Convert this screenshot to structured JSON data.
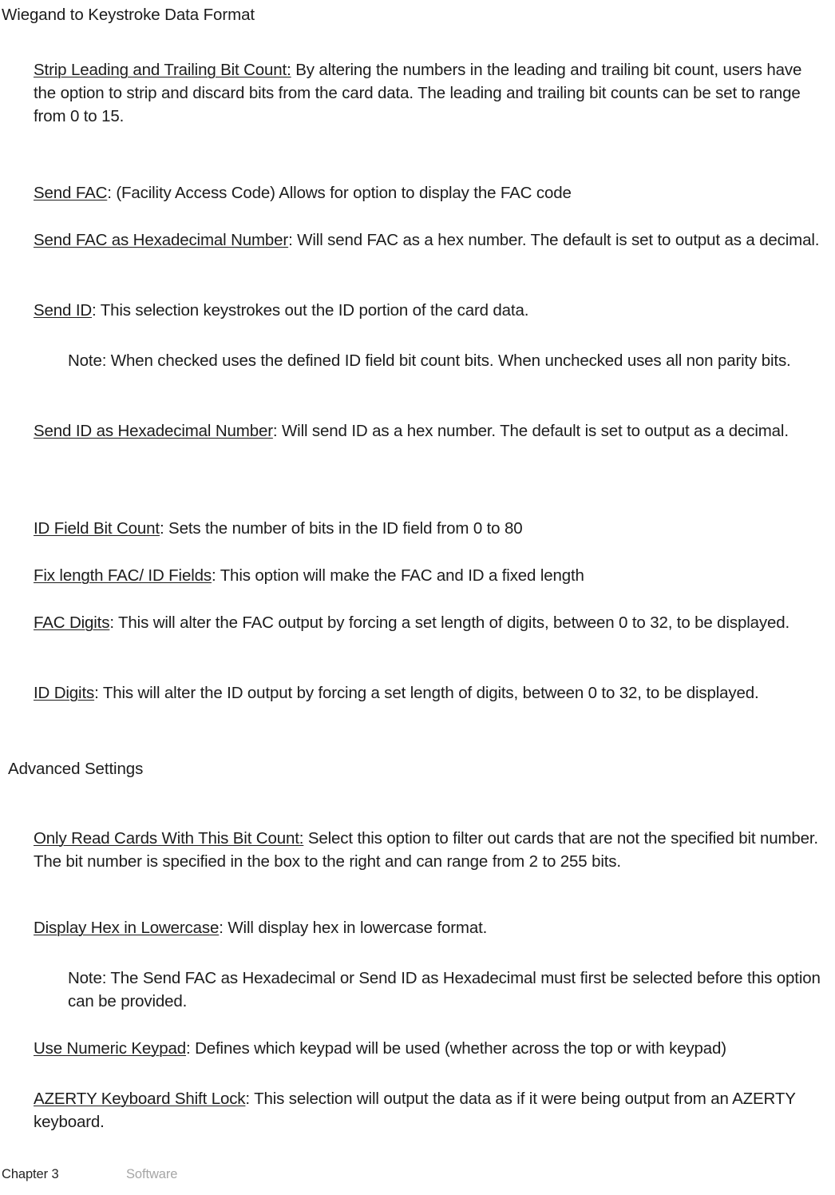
{
  "document": {
    "title": "Wiegand to Keystroke Data Format",
    "section_heading": "Advanced Settings"
  },
  "entries": {
    "strip_bit_count": {
      "term": "Strip Leading and Trailing Bit Count:",
      "description": " By altering  the numbers in the leading and trailing  bit count, users have the option to strip and discard bits from the card data. The leading and trailing  bit counts  can be set to range from 0 to 15."
    },
    "send_fac": {
      "term": "Send FAC",
      "description": ": (Facility  Access  Code)  Allows  for option to display the FAC code"
    },
    "send_fac_hex": {
      "term": "Send FAC as Hexadecimal  Number",
      "description": ":  Will  send FAC as a hex number.  The default  is set to output as a decimal."
    },
    "send_id": {
      "term": "Send ID",
      "description": ": This selection  keystrokes  out the ID portion of the card data."
    },
    "send_id_note": {
      "term": "",
      "description": "Note:  When checked  uses the defined ID field bit count bits. When unchecked  uses all non parity bits."
    },
    "send_id_hex": {
      "term": "Send ID as Hexadecimal  Number",
      "description": ":  Will  send ID as a hex number.  The default  is set to output as a decimal."
    },
    "id_field_bit_count": {
      "term": "ID Field Bit Count",
      "description": ":  Sets the number of bits in the ID field from 0 to 80"
    },
    "fix_length_fields": {
      "term": "Fix length  FAC/ ID Fields",
      "description": ": This option  will make the FAC and ID a fixed length"
    },
    "fac_digits": {
      "term": "FAC Digits",
      "description": ":  This will alter the FAC output by forcing  a set length of digits, between 0 to 32, to be displayed."
    },
    "id_digits": {
      "term": "ID Digits",
      "description": ": This will alter the ID output by forcing  a set length of digits, between 0 to 32, to be displayed."
    },
    "only_read_cards": {
      "term": "Only  Read Cards With  This Bit Count:",
      "description": " Select this option to filter out cards that are not the specified bit number.  The bit number is specified in the box to the right and can range from 2 to 255 bits."
    },
    "display_hex_lowercase": {
      "term": "Display Hex in Lowercase",
      "description": ": Will  display hex in lowercase format."
    },
    "display_hex_note": {
      "term": "",
      "description": "Note:  The Send FAC as Hexadecimal  or Send ID as Hexadecimal must  first be selected before this option  can be provided."
    },
    "use_numeric_keypad": {
      "term": "Use Numeric  Keypad",
      "description": ": Defines which  keypad will be used (whether across the top or with keypad)"
    },
    "azerty_shift_lock": {
      "term": "AZERTY Keyboard  Shift Lock",
      "description": ": This selection  will output the data as if it were being output from an AZERTY keyboard."
    }
  },
  "footer": {
    "chapter": "Chapter 3",
    "section": "Software"
  }
}
